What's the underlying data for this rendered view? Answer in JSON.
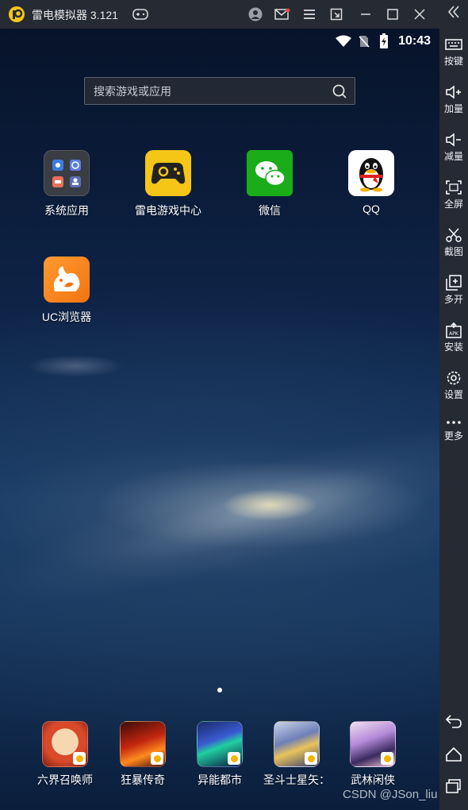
{
  "window": {
    "title": "雷电模拟器 3.121"
  },
  "status_bar": {
    "time": "10:43"
  },
  "search": {
    "placeholder": "搜索游戏或应用"
  },
  "home_apps": [
    {
      "label": "系统应用",
      "icon": "system-apps-folder-icon"
    },
    {
      "label": "雷电游戏中心",
      "icon": "game-center-icon"
    },
    {
      "label": "微信",
      "icon": "wechat-icon"
    },
    {
      "label": "QQ",
      "icon": "qq-penguin-icon"
    },
    {
      "label": "UC浏览器",
      "icon": "uc-browser-icon"
    }
  ],
  "dock_apps": [
    {
      "label": "六界召唤师",
      "icon": "game-icon"
    },
    {
      "label": "狂暴传奇",
      "icon": "game-icon"
    },
    {
      "label": "异能都市",
      "icon": "game-icon"
    },
    {
      "label": "圣斗士星矢：",
      "icon": "game-icon"
    },
    {
      "label": "武林闲侠",
      "icon": "game-icon"
    }
  ],
  "sidebar": {
    "items": [
      {
        "label": "按键",
        "icon": "keyboard-icon"
      },
      {
        "label": "加量",
        "icon": "volume-up-icon"
      },
      {
        "label": "减量",
        "icon": "volume-down-icon"
      },
      {
        "label": "全屏",
        "icon": "fullscreen-icon"
      },
      {
        "label": "截图",
        "icon": "scissors-icon"
      },
      {
        "label": "多开",
        "icon": "multi-instance-icon"
      },
      {
        "label": "安装",
        "icon": "apk-install-icon"
      },
      {
        "label": "设置",
        "icon": "gear-icon"
      },
      {
        "label": "更多",
        "icon": "more-dots-icon"
      }
    ]
  },
  "watermark": "CSDN @JSon_liu",
  "colors": {
    "titlebar": "#262a33",
    "accent_yellow": "#f5c518",
    "wechat_green": "#1aad19",
    "uc_orange": "#f58220"
  }
}
